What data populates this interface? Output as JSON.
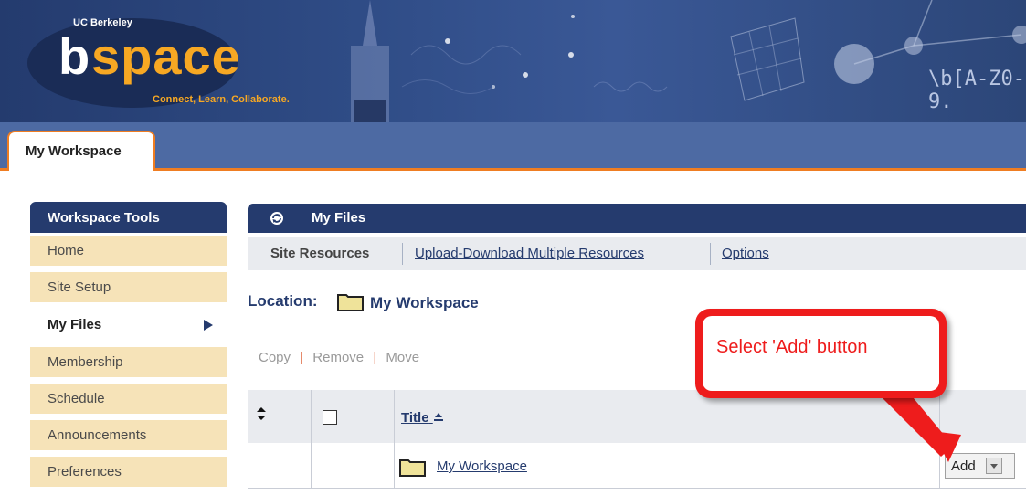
{
  "header": {
    "org": "UC Berkeley",
    "brand_b": "b",
    "brand_rest": "space",
    "tagline": "Connect, Learn, Collaborate.",
    "decor_text": "\\b[A-Z0-9.",
    "colors": {
      "banner": "#2f4c86",
      "brand_orange": "#f7a823"
    }
  },
  "tabs": [
    {
      "label": "My Workspace",
      "active": true
    }
  ],
  "sidebar": {
    "title": "Workspace Tools",
    "items": [
      {
        "label": "Home"
      },
      {
        "label": "Site Setup"
      },
      {
        "label": "My Files",
        "active": true
      },
      {
        "label": "Membership"
      },
      {
        "label": "Schedule"
      },
      {
        "label": "Announcements"
      },
      {
        "label": "Preferences"
      }
    ]
  },
  "main": {
    "title": "My Files",
    "toolbar": [
      {
        "label": "Site Resources",
        "active": true
      },
      {
        "label": "Upload-Download Multiple Resources"
      },
      {
        "label": "Options"
      }
    ],
    "location_label": "Location:",
    "location_name": "My Workspace",
    "actions": {
      "copy": "Copy",
      "remove": "Remove",
      "move": "Move",
      "separator": "|"
    },
    "table": {
      "title_header": "Title",
      "rows": [
        {
          "name": "My Workspace",
          "action": "Add"
        }
      ]
    }
  },
  "annotation": {
    "text": "Select 'Add' button",
    "color": "#ee1c1c"
  },
  "icons": [
    "sync-icon",
    "folder-icon",
    "sort-icon",
    "sort-ascending-icon",
    "dropdown-arrow-icon",
    "nav-arrow-icon"
  ]
}
